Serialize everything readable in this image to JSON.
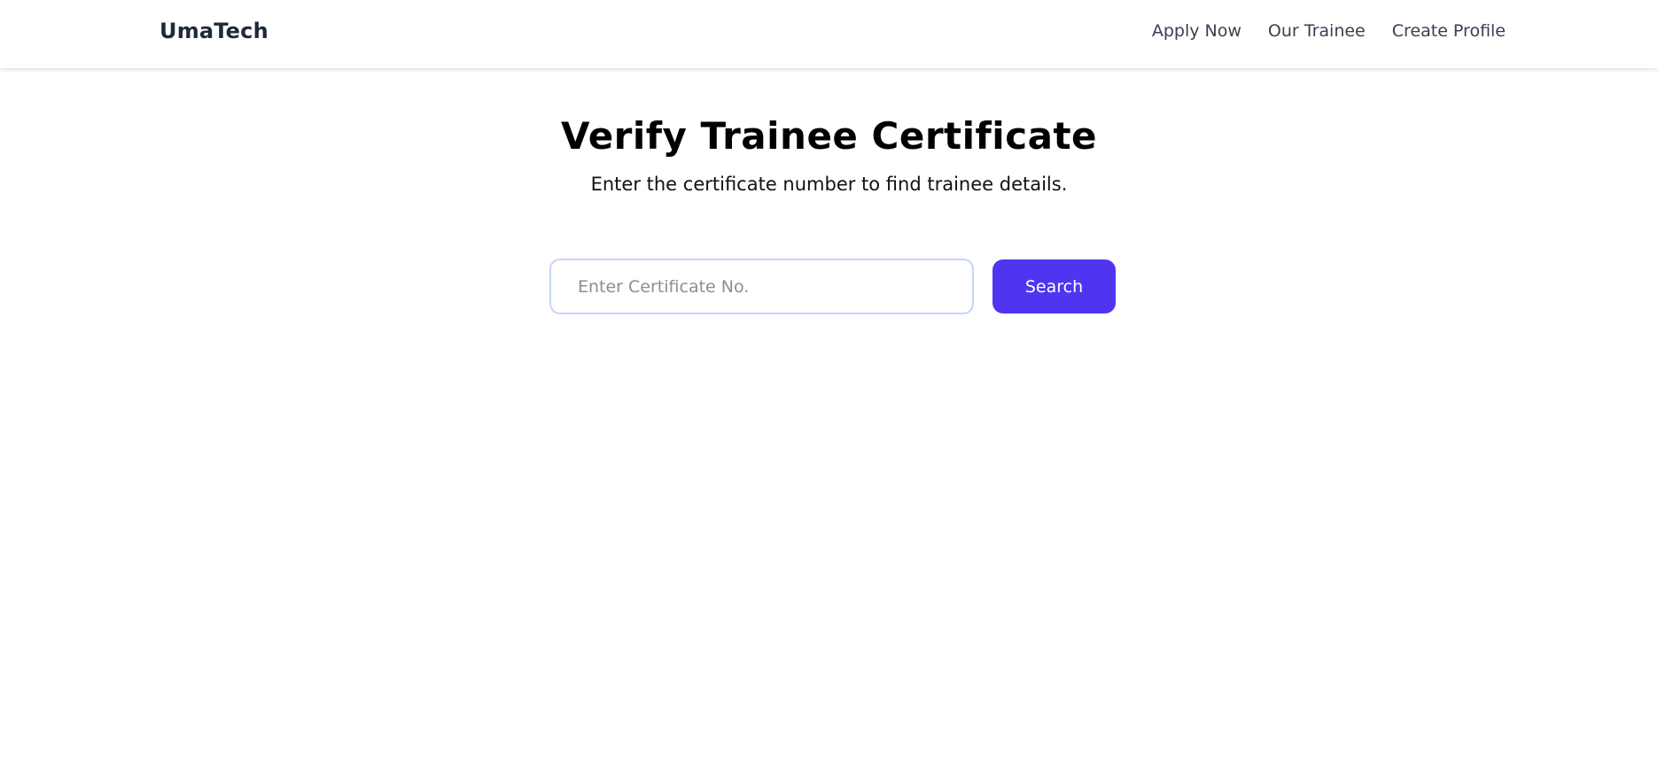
{
  "navbar": {
    "brand": "UmaTech",
    "links": [
      {
        "label": "Apply Now"
      },
      {
        "label": "Our Trainee"
      },
      {
        "label": "Create Profile"
      }
    ]
  },
  "hero": {
    "title": "Verify Trainee Certificate",
    "subtitle": "Enter the certificate number to find trainee details."
  },
  "search": {
    "placeholder": "Enter Certificate No.",
    "value": "",
    "button_label": "Search"
  },
  "colors": {
    "accent": "#4f35f0",
    "input_border": "#c7d2fe",
    "text_dark": "#1f2937"
  }
}
